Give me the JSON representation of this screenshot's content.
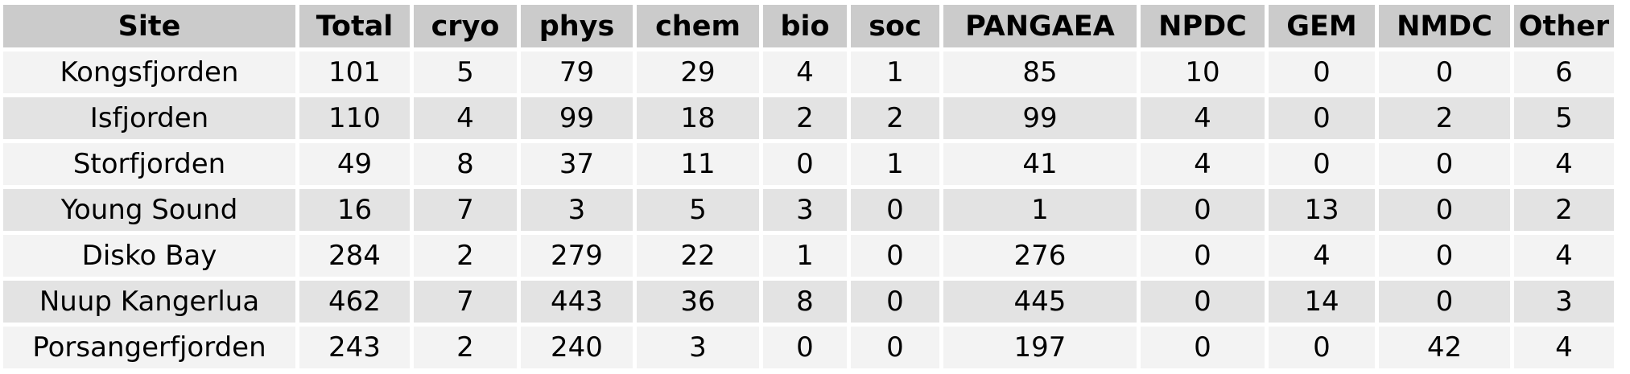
{
  "table": {
    "headers": [
      "Site",
      "Total",
      "cryo",
      "phys",
      "chem",
      "bio",
      "soc",
      "PANGAEA",
      "NPDC",
      "GEM",
      "NMDC",
      "Other"
    ],
    "rows": [
      [
        "Kongsfjorden",
        "101",
        "5",
        "79",
        "29",
        "4",
        "1",
        "85",
        "10",
        "0",
        "0",
        "6"
      ],
      [
        "Isfjorden",
        "110",
        "4",
        "99",
        "18",
        "2",
        "2",
        "99",
        "4",
        "0",
        "2",
        "5"
      ],
      [
        "Storfjorden",
        "49",
        "8",
        "37",
        "11",
        "0",
        "1",
        "41",
        "4",
        "0",
        "0",
        "4"
      ],
      [
        "Young Sound",
        "16",
        "7",
        "3",
        "5",
        "3",
        "0",
        "1",
        "0",
        "13",
        "0",
        "2"
      ],
      [
        "Disko Bay",
        "284",
        "2",
        "279",
        "22",
        "1",
        "0",
        "276",
        "0",
        "4",
        "0",
        "4"
      ],
      [
        "Nuup Kangerlua",
        "462",
        "7",
        "443",
        "36",
        "8",
        "0",
        "445",
        "0",
        "14",
        "0",
        "3"
      ],
      [
        "Porsangerfjorden",
        "243",
        "2",
        "240",
        "3",
        "0",
        "0",
        "197",
        "0",
        "0",
        "42",
        "4"
      ]
    ]
  },
  "colors": {
    "header_bg": "#cbcbcb",
    "row_light": "#f3f3f3",
    "row_dark": "#e3e3e3",
    "grid": "#ffffff"
  }
}
